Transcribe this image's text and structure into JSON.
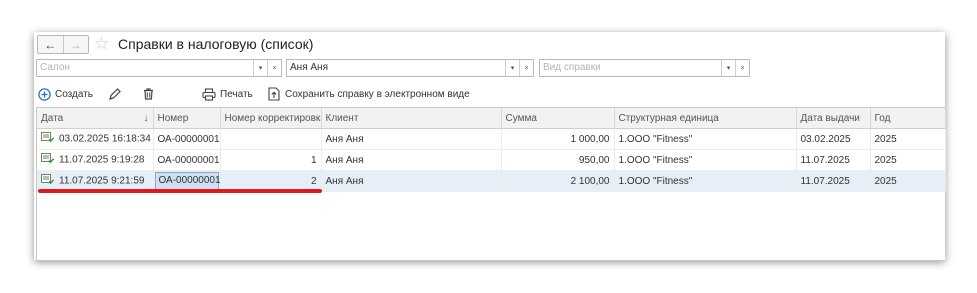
{
  "window": {
    "title": "Справки в налоговую (список)",
    "nav": {
      "back": "←",
      "forward": "→"
    },
    "star": "☆"
  },
  "filters": {
    "salon": {
      "value": "",
      "placeholder": "Салон"
    },
    "client": {
      "value": "Аня Аня",
      "placeholder": ""
    },
    "kind": {
      "value": "",
      "placeholder": "Вид справки"
    },
    "dropdown_glyph": "▾",
    "clear_glyph": "×"
  },
  "toolbar": {
    "create_label": "Создать",
    "print_label": "Печать",
    "save_label": "Сохранить справку в электронном виде"
  },
  "table": {
    "sort_indicator": "↓",
    "columns": [
      "Дата",
      "Номер",
      "Номер корректировки",
      "Клиент",
      "Сумма",
      "Структурная единица",
      "Дата выдачи",
      "Год"
    ],
    "rows": [
      {
        "date": "03.02.2025 16:18:34",
        "number": "ОА-00000001",
        "correction": "",
        "client": "Аня Аня",
        "sum": "1 000,00",
        "unit": "1.ООО \"Fitness\"",
        "issue_date": "03.02.2025",
        "year": "2025"
      },
      {
        "date": "11.07.2025 9:19:28",
        "number": "ОА-00000001",
        "correction": "1",
        "client": "Аня Аня",
        "sum": "950,00",
        "unit": "1.ООО \"Fitness\"",
        "issue_date": "11.07.2025",
        "year": "2025"
      },
      {
        "date": "11.07.2025 9:21:59",
        "number": "ОА-00000001",
        "correction": "2",
        "client": "Аня Аня",
        "sum": "2 100,00",
        "unit": "1.ООО \"Fitness\"",
        "issue_date": "11.07.2025",
        "year": "2025"
      }
    ]
  },
  "colors": {
    "accent": "#2a73c9",
    "highlight_line": "#e0191e",
    "selected_row": "#e6eef7"
  }
}
